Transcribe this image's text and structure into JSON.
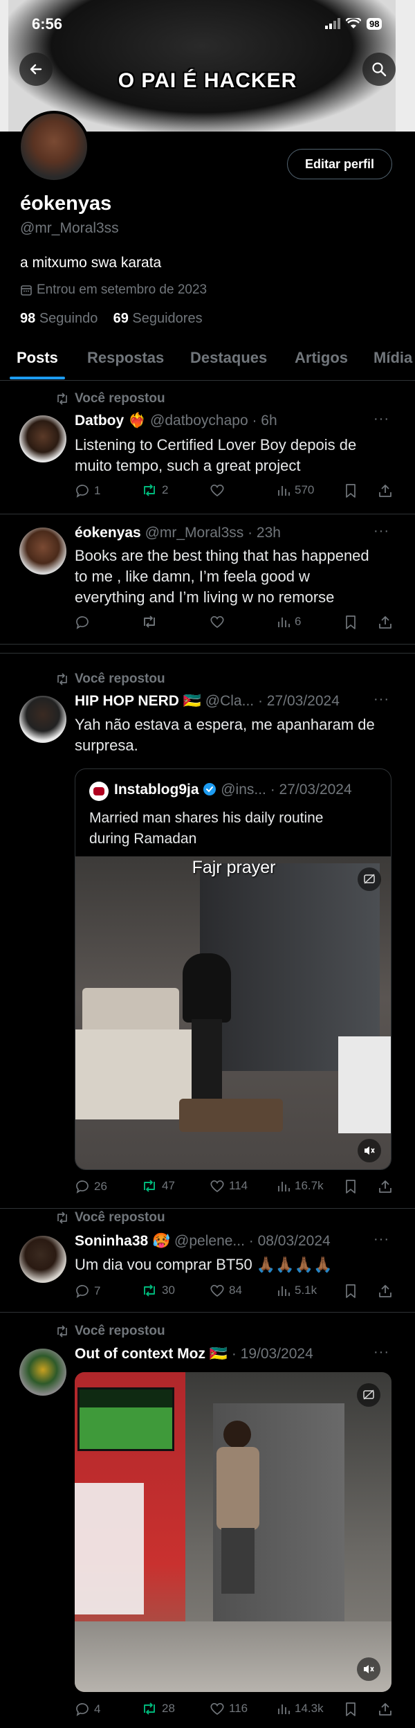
{
  "status_bar": {
    "time": "6:56",
    "battery": "98"
  },
  "banner": {
    "caption": "O PAI É HACKER"
  },
  "profile": {
    "edit_button": "Editar perfil",
    "display_name": "éokenyas",
    "handle": "@mr_Moral3ss",
    "bio": "a mitxumo swa karata",
    "joined": "Entrou em setembro de 2023",
    "following_count": "98",
    "following_label": "Seguindo",
    "followers_count": "69",
    "followers_label": "Seguidores"
  },
  "tabs": [
    "Posts",
    "Respostas",
    "Destaques",
    "Artigos",
    "Mídia"
  ],
  "repost_label": "Você repostou",
  "posts": [
    {
      "name": "Datboy",
      "emoji": "❤️‍🔥",
      "handle": "@datboychapo",
      "time": "· 6h",
      "text": [
        "Listening to Certified Lover Boy depois de",
        "muito tempo, such a great project"
      ],
      "replies": "1",
      "reposts": "2",
      "likes": "",
      "views": "570"
    },
    {
      "name": "éokenyas",
      "handle": "@mr_Moral3ss",
      "time": "· 23h",
      "text": [
        "Books are the best thing that has happened",
        "to me , like damn, I’m feela good w",
        "everything and I’m living w no remorse"
      ],
      "replies": "",
      "reposts": "",
      "likes": "",
      "views": "6"
    },
    {
      "name": "HIP HOP NERD",
      "emoji": "🇲🇿",
      "handle": "@Cla...",
      "time": "· 27/03/2024",
      "text": [
        "Yah não estava a espera, me apanharam de",
        "surpresa."
      ],
      "quote": {
        "name": "Instablog9ja",
        "handle": "@ins...",
        "time": "· 27/03/2024",
        "text": [
          "Married man shares his daily routine",
          "during Ramadan"
        ],
        "video_caption": "Fajr prayer"
      },
      "replies": "26",
      "reposts": "47",
      "likes": "114",
      "views": "16.7k"
    },
    {
      "name": "Soninha38",
      "emoji": "🥵",
      "handle": "@pelene...",
      "time": "· 08/03/2024",
      "text": [
        "Um dia vou comprar BT50 🙏🏾🙏🏾🙏🏾🙏🏾"
      ],
      "replies": "7",
      "reposts": "30",
      "likes": "84",
      "views": "5.1k"
    },
    {
      "name": "Out of context Moz",
      "emoji": "🇲🇿",
      "handle": "",
      "time": "· 19/03/2024",
      "text": [],
      "replies": "4",
      "reposts": "28",
      "likes": "116",
      "views": "14.3k"
    }
  ],
  "colors": {
    "accent": "#1d9bf0",
    "repost_green": "#00ba7c",
    "muted": "#71767b",
    "verified": "#1d9bf0"
  }
}
